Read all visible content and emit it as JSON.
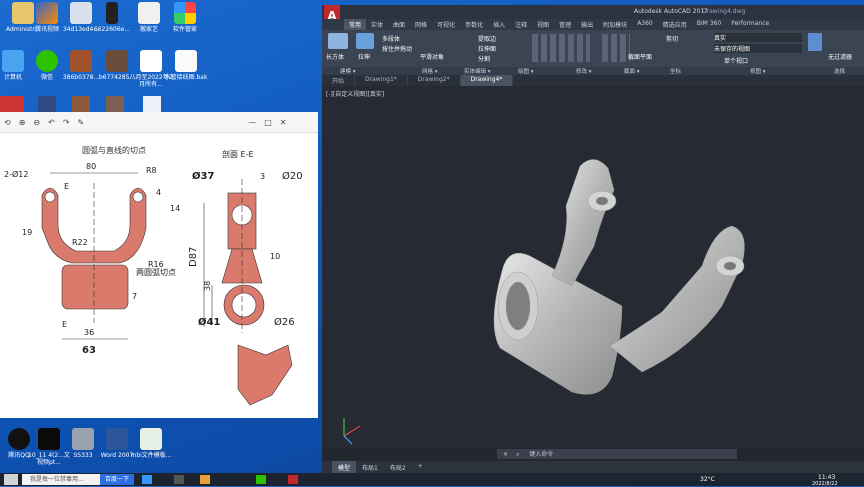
{
  "desktop_icons": [
    {
      "label": "Administr...",
      "icon": "user-folder-icon"
    },
    {
      "label": "腾讯视频",
      "icon": "video-app-icon"
    },
    {
      "label": "34d13ed4...",
      "icon": "image-file-icon"
    },
    {
      "label": "6622606e...",
      "icon": "phone-image-icon"
    },
    {
      "label": "搬家艺",
      "icon": "document-icon"
    },
    {
      "label": "软件管家",
      "icon": "software-manager-icon"
    },
    {
      "label": "计算机",
      "icon": "computer-icon"
    },
    {
      "label": "微信",
      "icon": "wechat-icon"
    },
    {
      "label": "386b0378...",
      "icon": "image-file-icon"
    },
    {
      "label": "b6774285...",
      "icon": "image-file-icon"
    },
    {
      "label": "八月至2022年2月所有...",
      "icon": "spreadsheet-icon"
    },
    {
      "label": "水管接线图.bak",
      "icon": "file-icon"
    },
    {
      "label": "腾讯QQ",
      "icon": "qq-icon"
    },
    {
      "label": "10_11 4(2...文视频pt...",
      "icon": "video-file-icon"
    },
    {
      "label": "SS333",
      "icon": "folder-icon"
    },
    {
      "label": "Word 2007",
      "icon": "word-icon"
    },
    {
      "label": "mbi文件模板...",
      "icon": "excel-icon"
    }
  ],
  "viewer": {
    "toolbar": [
      "⟲",
      "⊕",
      "⊖",
      "↶",
      "↷",
      "✎",
      "—",
      "□",
      "✕"
    ],
    "drawing": {
      "labels": {
        "tangent_top": "圆弧与直线的切点",
        "section": "剖面 E-E",
        "tangent_bottom": "两圆弧切点",
        "holes": "2-Ø12",
        "dim80": "80",
        "r8": "R8",
        "e_top": "E",
        "dim4": "4",
        "dim14": "14",
        "dim19": "19",
        "r22": "R22",
        "r16": "R16",
        "dim7": "7",
        "e_bottom": "E",
        "dim36": "36",
        "dim63": "63",
        "d37": "Ø37",
        "dim3": "3",
        "d20": "Ø20",
        "d87": "D87",
        "dim10": "10",
        "dim38": "38",
        "d41": "Ø41",
        "d26": "Ø26"
      }
    }
  },
  "acad": {
    "title": "Autodesk AutoCAD 2017",
    "title_right": "Drawing4.dwg",
    "logo": "A",
    "ribbon_tabs": [
      "常用",
      "实体",
      "曲面",
      "网格",
      "可视化",
      "参数化",
      "插入",
      "注释",
      "视图",
      "管理",
      "输出",
      "附加模块",
      "A360",
      "精选应用",
      "BIM 360",
      "Performance"
    ],
    "ribbon_buttons": [
      "长方体",
      "拉伸",
      "多段体",
      "按住并拖动",
      "平滑对象",
      "提取边",
      "拉伸面",
      "分割",
      "截面平面",
      "剪切",
      "真实",
      "未保存的视图",
      "单个视口",
      "无过滤器",
      "选择"
    ],
    "panel_names": [
      "建模 ▾",
      "网格 ▾",
      "实体编辑 ▾",
      "绘图 ▾",
      "修改 ▾",
      "截面 ▾",
      "坐标",
      "视图 ▾",
      "选择"
    ],
    "doc_tabs": [
      "开始",
      "Drawing1*",
      "Drawing2*",
      "Drawing4*"
    ],
    "viewport_label": "[-][自定义视图][真实]",
    "command_placeholder": "键入命令",
    "layout_tabs": [
      "模型",
      "布局1",
      "布局2",
      "+"
    ]
  },
  "taskbar": {
    "search_placeholder": "我是每一位禁毒用...",
    "search_button": "百度一下",
    "weather": "32°C",
    "time": "11:43",
    "date": "2022/8/22"
  },
  "colors": {
    "desktop": "#1260c4",
    "part_fill": "#d97a6c",
    "acad_bg": "#252a33"
  }
}
